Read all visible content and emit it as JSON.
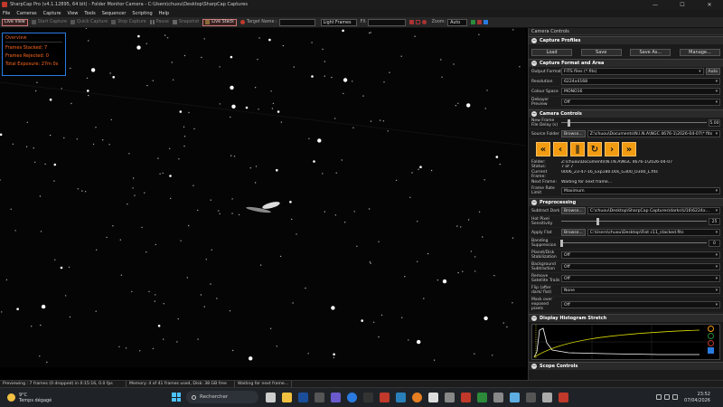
{
  "window": {
    "title": "SharpCap Pro (v4.1.12895, 64 bit) - Folder Monitor Camera - C:\\Users\\chuou\\Desktop\\SharpCap Captures",
    "controls": [
      "—",
      "☐",
      "✕"
    ]
  },
  "menu": [
    "File",
    "Cameras",
    "Capture",
    "View",
    "Tools",
    "Sequencer",
    "Scripting",
    "Help"
  ],
  "toolbar": {
    "live_view": "Live View",
    "start_capture": "Start Capture",
    "quick_capture": "Quick Capture",
    "stop_capture": "Stop Capture",
    "pause": "Pause",
    "snapshot": "Snapshot",
    "live_stack": "Live Stack",
    "target_name_label": "Target Name :",
    "target_name_value": "",
    "light_frames": "Light Frames",
    "fx_label": "FX",
    "fx_value": "",
    "zoom_label": "Zoom:",
    "zoom_value": "Auto"
  },
  "overview": {
    "title": "Overview",
    "frames_stacked": "Frames Stacked: 7",
    "frames_rejected": "Frames Rejected: 0",
    "total_exposure": "Total Exposure: 27m 0s"
  },
  "panel": {
    "header": "Camera Controls",
    "capture_profiles": {
      "title": "Capture Profiles",
      "load": "Load",
      "save": "Save",
      "save_as": "Save As...",
      "manage": "Manage..."
    },
    "capture_format": {
      "title": "Capture Format and Area",
      "output_format_label": "Output Format",
      "output_format_value": "FITS files (*.fits)",
      "auto": "Auto",
      "resolution_label": "Resolution",
      "resolution_value": "6224x4168",
      "colour_space_label": "Colour Space",
      "colour_space_value": "MONO16",
      "debayer_label": "Debayer Preview",
      "debayer_value": "Off"
    },
    "camera_controls": {
      "title": "Camera Controls",
      "new_frame_label": "New Frame File Delay (s)",
      "new_frame_value": "5.00",
      "new_frame_fraction": 0.05,
      "source_folder_label": "Source Folder",
      "browse": "Browse...",
      "source_folder_value": "Z:\\chuou\\Documents\\N.I.N.A\\NGC 4676-1\\2026-04-07\\* fits",
      "info": [
        {
          "k": "Folder:",
          "v": "Z:\\chuou\\Documents\\N.I.N.A\\NGC 4676-1\\2026-04-07"
        },
        {
          "k": "Status:",
          "v": "7 of 7"
        },
        {
          "k": "Current Frame:",
          "v": "0006_23-47-16_Exp180.00s_G300_O300_L.fits"
        },
        {
          "k": "Next Frame:",
          "v": "Waiting for next frame..."
        }
      ],
      "frame_rate_label": "Frame Rate Limit",
      "frame_rate_value": "Maximum"
    },
    "preprocessing": {
      "title": "Preprocessing",
      "subtract_dark_label": "Subtract Dark",
      "subtract_dark_value": "C:\\chuou\\Desktop\\SharpCap Captures\\darks\\U16\\6224x...",
      "hot_pixel_label": "Hot Pixel Sensitivity",
      "hot_pixel_value": "25",
      "hot_pixel_fraction": 0.25,
      "apply_flat_label": "Apply Flat",
      "apply_flat_value": "C:\\Users\\chuou\\Desktop\\Flat c11_stacked.fits",
      "banding_label": "Banding Suppression",
      "banding_value": "0",
      "banding_fraction": 0.0,
      "planet_label": "Planet/Disk Stabilization",
      "planet_value": "Off",
      "background_label": "Background Subtraction",
      "background_value": "Off",
      "remove_sat_label": "Remove Satellite Trails",
      "remove_sat_value": "Off",
      "flip_label": "Flip (after dark/ flat)",
      "flip_value": "None",
      "mask_label": "Mask over exposed pixels",
      "mask_value": "Off"
    },
    "histogram": {
      "title": "Display Histogram Stretch"
    },
    "scope": {
      "title": "Scope Controls"
    }
  },
  "status": {
    "previewing": "Previewing : 7 frames (0 dropped) in 0:15:16, 0.0 fps",
    "memory": "Memory: 4 of 41 frames used, Disk: 38 GB free",
    "waiting": "Waiting for next frame..."
  },
  "taskbar": {
    "temp": "9°C",
    "weather": "Temps dégagé",
    "search": "Rechercher",
    "time": "23:52",
    "date": "07/04/2026"
  },
  "colors": {
    "accent_orange": "#f39c12",
    "overview_border": "#2a7be0",
    "overview_text": "#ff6a20"
  }
}
